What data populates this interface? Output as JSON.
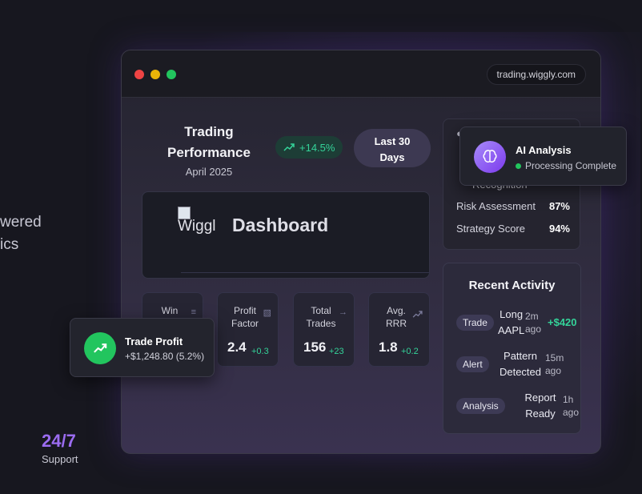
{
  "hero": {
    "line1": "wered",
    "line2": "ics"
  },
  "support": {
    "value": "24/7",
    "label": "Support"
  },
  "window": {
    "url": "trading.wiggly.com"
  },
  "performance": {
    "title_line1": "Trading",
    "title_line2": "Performance",
    "date": "April 2025",
    "change": "+14.5%",
    "range_line1": "Last 30",
    "range_line2": "Days"
  },
  "dashboard": {
    "img_alt": "Wiggl",
    "title": "Dashboard"
  },
  "metrics": [
    {
      "label_line1": "Win",
      "label_line2": "",
      "value": "",
      "change": "",
      "icon": "bar-chart-icon"
    },
    {
      "label_line1": "Profit",
      "label_line2": "Factor",
      "value": "2.4",
      "change": "+0.3",
      "icon": "bar-chart-icon"
    },
    {
      "label_line1": "Total",
      "label_line2": "Trades",
      "value": "156",
      "change": "+23",
      "icon": "arrow-right-icon"
    },
    {
      "label_line1": "Avg.",
      "label_line2": "RRR",
      "value": "1.8",
      "change": "+0.2",
      "icon": "trending-up-icon"
    }
  ],
  "ai_panel": {
    "partial_label": "Recognition",
    "rows": [
      {
        "label": "Risk Assessment",
        "value": "87%"
      },
      {
        "label": "Strategy Score",
        "value": "94%"
      }
    ]
  },
  "activity": {
    "title": "Recent Activity",
    "items": [
      {
        "tag": "Trade",
        "text_line1": "Long",
        "text_line2": "AAPL",
        "time_line1": "2m",
        "time_line2": "ago",
        "amount": "+$420"
      },
      {
        "tag": "Alert",
        "text_line1": "Pattern",
        "text_line2": "Detected",
        "time_line1": "15m",
        "time_line2": "ago",
        "amount": ""
      },
      {
        "tag": "Analysis",
        "text_line1": "Report",
        "text_line2": "Ready",
        "time_line1": "1h",
        "time_line2": "ago",
        "amount": ""
      }
    ]
  },
  "ai_toast": {
    "title": "AI Analysis",
    "status": "Processing Complete"
  },
  "trade_toast": {
    "title": "Trade Profit",
    "detail": "+$1,248.80 (5.2%)"
  },
  "colors": {
    "accent": "#9b6cf0",
    "positive": "#34d399",
    "success": "#22c55e"
  }
}
